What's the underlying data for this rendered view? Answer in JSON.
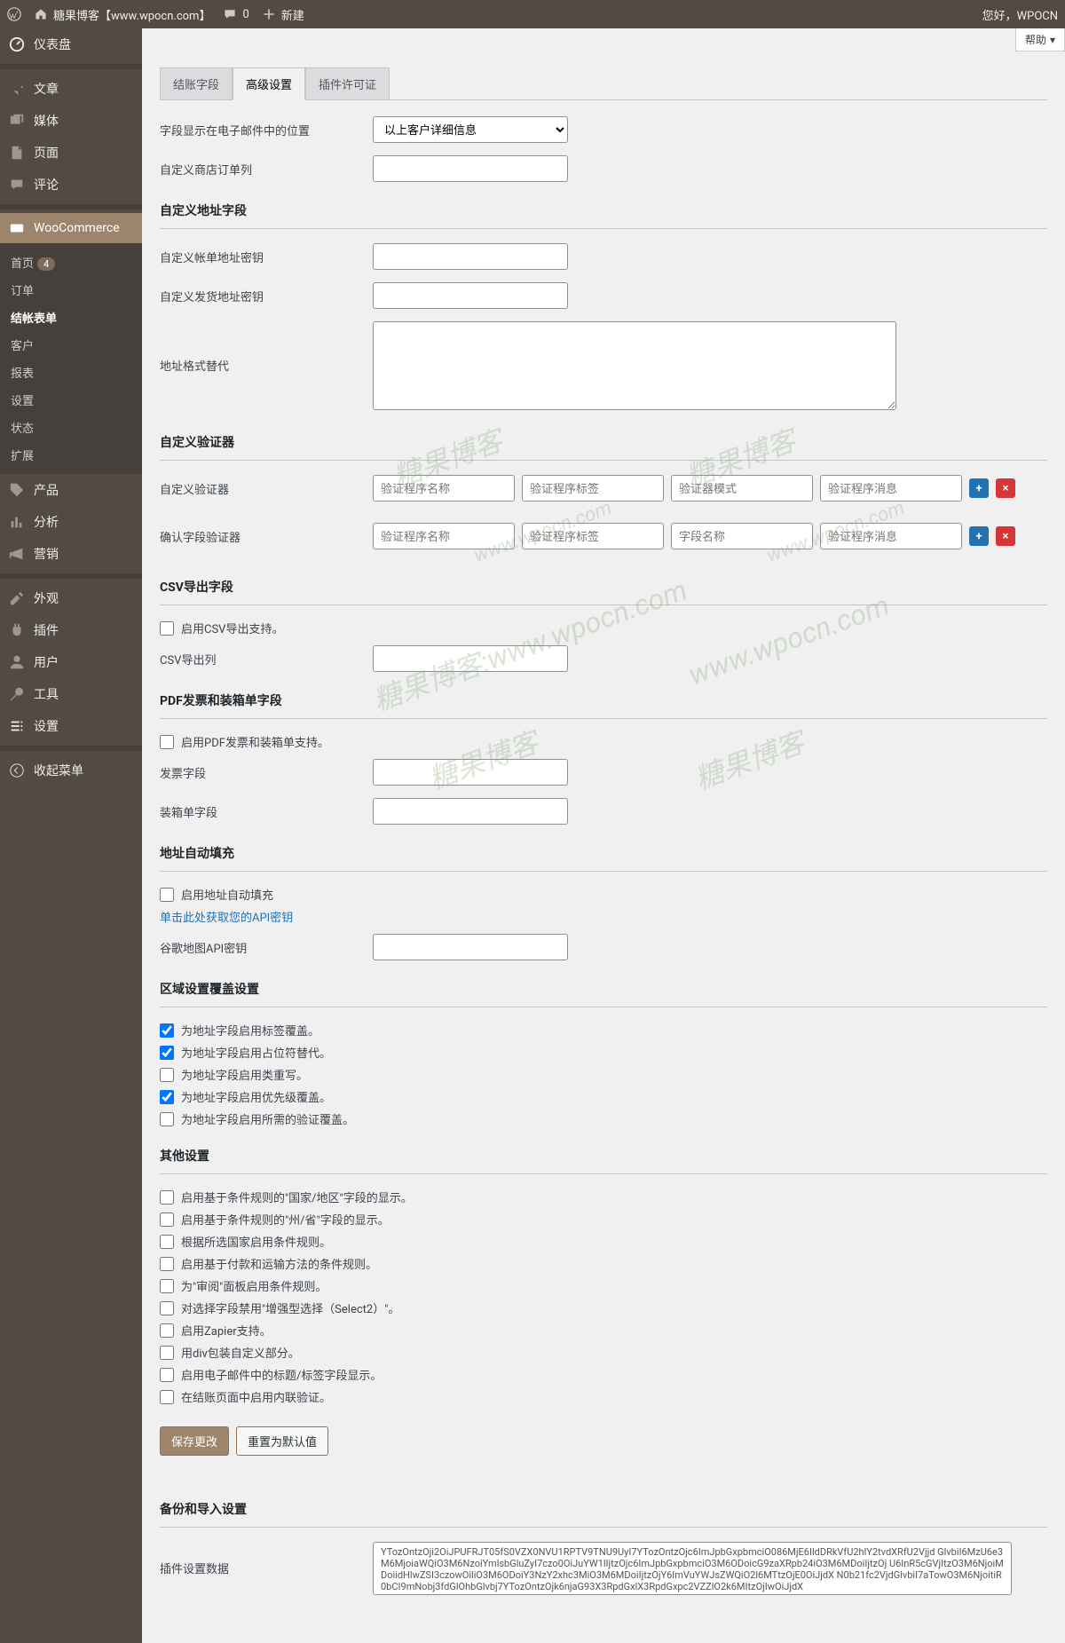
{
  "adminbar": {
    "site_title": "糖果博客【www.wpocn.com】",
    "comments": "0",
    "new": "新建",
    "greeting": "您好，WPOCN"
  },
  "help_btn": "帮助",
  "sidebar": {
    "dashboard": "仪表盘",
    "posts": "文章",
    "media": "媒体",
    "pages": "页面",
    "comments": "评论",
    "woocommerce": "WooCommerce",
    "wc_sub": {
      "home": "首页",
      "home_badge": "4",
      "orders": "订单",
      "checkout_form": "结帐表单",
      "customers": "客户",
      "reports": "报表",
      "settings": "设置",
      "status": "状态",
      "extensions": "扩展"
    },
    "products": "产品",
    "analytics": "分析",
    "marketing": "营销",
    "appearance": "外观",
    "plugins": "插件",
    "users": "用户",
    "tools": "工具",
    "settings": "设置",
    "collapse": "收起菜单"
  },
  "tabs": {
    "checkout_fields": "结账字段",
    "advanced": "高级设置",
    "license": "插件许可证"
  },
  "fields": {
    "email_position_label": "字段显示在电子邮件中的位置",
    "email_position_value": "以上客户详细信息",
    "custom_shop_order_label": "自定义商店订单列"
  },
  "sections": {
    "address_fields": "自定义地址字段",
    "validators": "自定义验证器",
    "csv": "CSV导出字段",
    "pdf": "PDF发票和装箱单字段",
    "autofill": "地址自动填充",
    "locale": "区域设置覆盖设置",
    "other": "其他设置",
    "backup": "备份和导入设置"
  },
  "address": {
    "billing_key_label": "自定义帐单地址密钥",
    "shipping_key_label": "自定义发货地址密钥",
    "format_label": "地址格式替代"
  },
  "validators": {
    "custom_label": "自定义验证器",
    "confirm_label": "确认字段验证器",
    "ph_name": "验证程序名称",
    "ph_tag": "验证程序标签",
    "ph_mode": "验证器模式",
    "ph_field": "字段名称",
    "ph_msg": "验证程序消息"
  },
  "csv": {
    "enable": "启用CSV导出支持。",
    "cols_label": "CSV导出列"
  },
  "pdf": {
    "enable": "启用PDF发票和装箱单支持。",
    "invoice_label": "发票字段",
    "packing_label": "装箱单字段"
  },
  "autofill": {
    "enable": "启用地址自动填充",
    "api_link": "单击此处获取您的API密钥",
    "google_key_label": "谷歌地图API密钥"
  },
  "locale": {
    "c1": "为地址字段启用标签覆盖。",
    "c2": "为地址字段启用占位符替代。",
    "c3": "为地址字段启用类重写。",
    "c4": "为地址字段启用优先级覆盖。",
    "c5": "为地址字段启用所需的验证覆盖。"
  },
  "other": {
    "o1": "启用基于条件规则的\"国家/地区\"字段的显示。",
    "o2": "启用基于条件规则的\"州/省\"字段的显示。",
    "o3": "根据所选国家启用条件规则。",
    "o4": "启用基于付款和运输方法的条件规则。",
    "o5": "为\"审阅\"面板启用条件规则。",
    "o6": "对选择字段禁用\"增强型选择（Select2）\"。",
    "o7": "启用Zapier支持。",
    "o8": "用div包装自定义部分。",
    "o9": "启用电子邮件中的标题/标签字段显示。",
    "o10": "在结账页面中启用内联验证。"
  },
  "actions": {
    "save": "保存更改",
    "reset": "重置为默认值"
  },
  "backup": {
    "data_label": "插件设置数据",
    "data_value": "YTozOntzOji2OiJPUFRJT05fS0VZX0NVU1RPTV9TNU9UyI7YTozOntzOjc6ImJpbGxpbmciO086MjE6IldDRkVfU2hlY2tvdXRfU2Vjjd GlvbiI6MzU6e3M6MjoiaWQiO3M6NzoiYmlsbGluZyI7czo0OiJuYW1lIjtzOjc6ImJpbGxpbmciO3M6ODoicG9zaXRpb24iO3M6MDoiIjtzOj U6InR5cGVjItzO3M6NjoiMDoiidHlwZSI3czowOiliO3M6ODoiY3NzY2xhc3MiO3M6MDoiIjtzOjY6ImVuYWJsZWQiO2l6MTtzOjE0OiJjdX N0b21fc2VjdGlvbiI7aTowO3M6NjoitiR0bCI9mNobj3fdGlOhbGlvbj7YTozOntzOjk6njaG93X3RpdGxlX3RpdGxpc2VZZlO2k6MItzOjIwOiJjdX"
  }
}
